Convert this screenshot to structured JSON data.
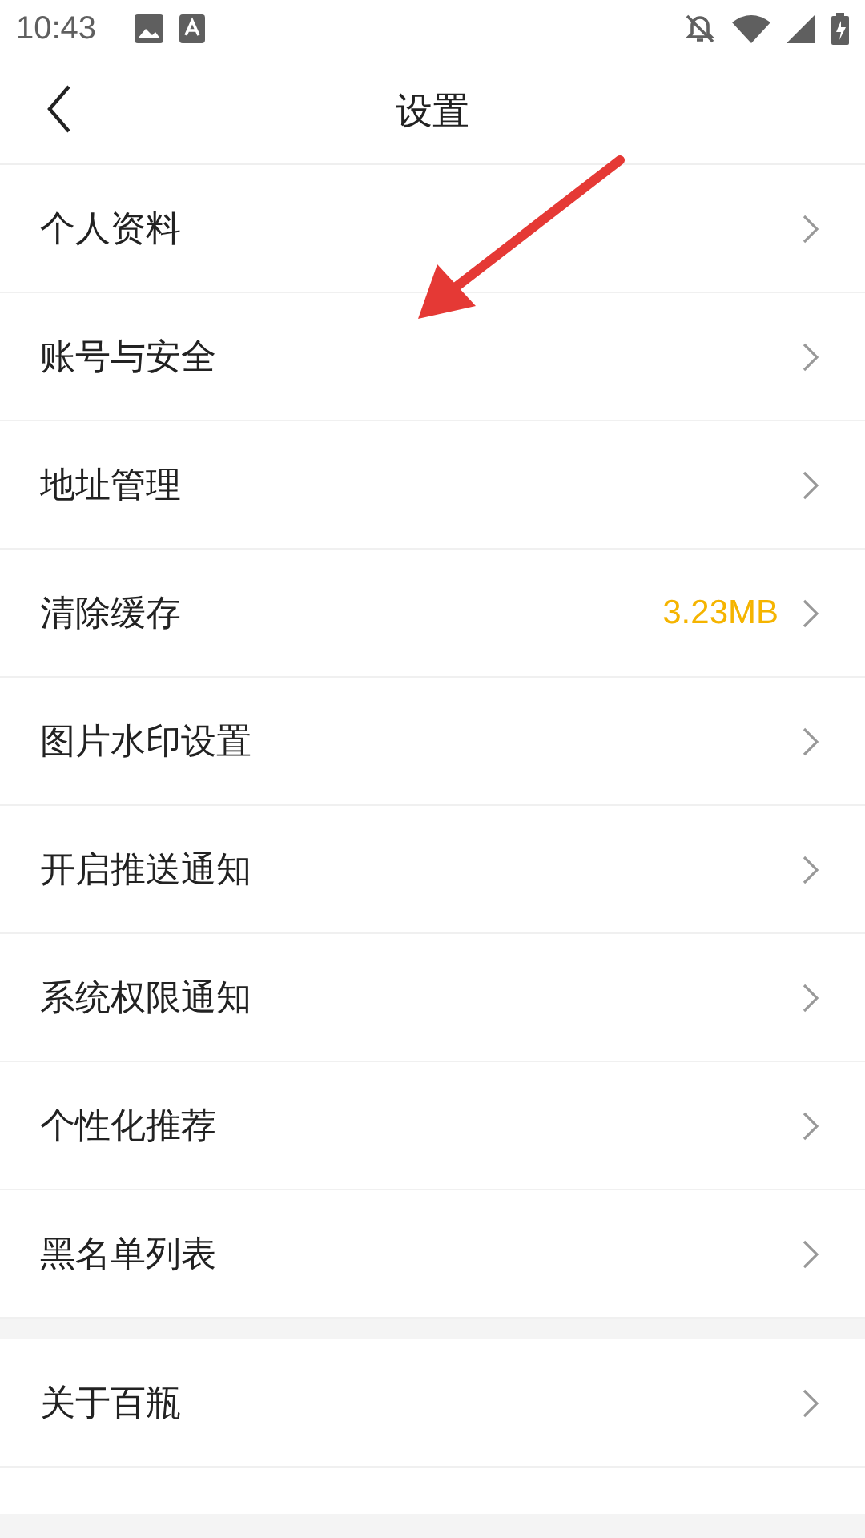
{
  "status_bar": {
    "time": "10:43"
  },
  "header": {
    "title": "设置"
  },
  "groups": [
    {
      "items": [
        {
          "label": "个人资料"
        },
        {
          "label": "账号与安全"
        },
        {
          "label": "地址管理"
        },
        {
          "label": "清除缓存",
          "value": "3.23MB"
        },
        {
          "label": "图片水印设置"
        },
        {
          "label": "开启推送通知"
        },
        {
          "label": "系统权限通知"
        },
        {
          "label": "个性化推荐"
        },
        {
          "label": "黑名单列表"
        }
      ]
    },
    {
      "items": [
        {
          "label": "关于百瓶"
        }
      ]
    }
  ]
}
